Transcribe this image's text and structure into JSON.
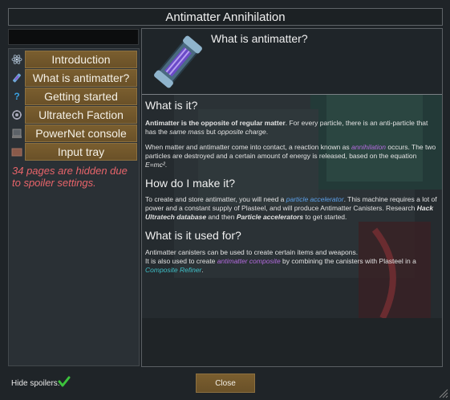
{
  "window": {
    "title": "Antimatter Annihilation"
  },
  "search": {
    "value": ""
  },
  "sidebar": {
    "items": [
      {
        "label": "Introduction",
        "icon": "atom-icon"
      },
      {
        "label": "What is antimatter?",
        "icon": "canister-icon"
      },
      {
        "label": "Getting started",
        "icon": "question-icon"
      },
      {
        "label": "Ultratech Faction",
        "icon": "faction-icon"
      },
      {
        "label": "PowerNet console",
        "icon": "console-icon"
      },
      {
        "label": "Input tray",
        "icon": "tray-icon"
      }
    ],
    "spoiler_note": "34 pages are hidden due to spoiler settings."
  },
  "page": {
    "title": "What is antimatter?",
    "sections": [
      {
        "heading": "What is it?"
      },
      {
        "heading": "How do I make it?"
      },
      {
        "heading": "What is it used for?"
      }
    ],
    "s1p1": {
      "a": "Antimatter is the opposite of regular matter",
      "b": ". For every particle, there is an anti-particle that has the ",
      "c": "same mass",
      "d": " but ",
      "e": "opposite charge",
      "f": "."
    },
    "s1p2": {
      "a": "When matter and antimatter come into contact, a reaction known as ",
      "b": "annihilation",
      "c": " occurs. The two particles are destroyed and a certain amount of energy is released, based on the equation ",
      "d": "E=mc²",
      "e": "."
    },
    "s2p1": {
      "a": "To create and store antimatter, you will need a ",
      "b": "particle accelerator",
      "c": ". This machine requires a lot of power and a constant supply of Plasteel, and will produce Antimatter Canisters. Research ",
      "d": "Hack Ultratech database",
      "e": " and then ",
      "f": "Particle accelerators",
      "g": " to get started."
    },
    "s3p1": {
      "a": "Antimatter canisters can be used to create certain items and weapons.",
      "b": "It is also used to create ",
      "c": "antimatter composite",
      "d": " by combining the canisters with Plasteel in a ",
      "e": "Composite Refiner",
      "f": "."
    }
  },
  "footer": {
    "hide_spoilers_label": "Hide spoilers:",
    "hide_spoilers_checked": true,
    "close_label": "Close"
  },
  "colors": {
    "button": "#7a5e2f",
    "spoiler_note": "#e8646a",
    "link_purple": "#b56be0",
    "link_blue": "#5da0e8",
    "link_teal": "#3fc0c8",
    "check": "#3cc23c"
  }
}
